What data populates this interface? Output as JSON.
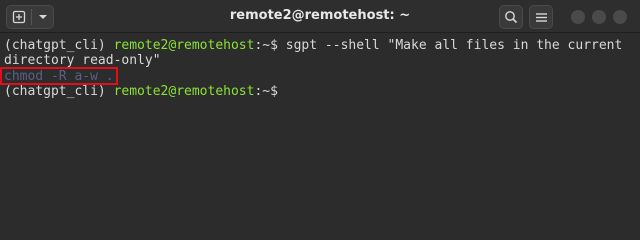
{
  "window": {
    "title": "remote2@remotehost: ~"
  },
  "toolbar": {
    "new_tab_icon": "new-tab-icon",
    "menu_icon": "chevron-down-icon",
    "search_icon": "search-icon",
    "hamburger_icon": "hamburger-menu-icon"
  },
  "terminal": {
    "lines": [
      {
        "env": "(chatgpt_cli) ",
        "user": "remote2@remotehost",
        "path": ":~$ ",
        "cmd": "sgpt --shell \"Make all files in the current"
      },
      {
        "text": "directory read-only\""
      },
      {
        "output": "chmod -R a-w ."
      },
      {
        "env": "(chatgpt_cli) ",
        "user": "remote2@remotehost",
        "path": ":~$ "
      }
    ]
  },
  "colors": {
    "background": "#2c2c2c",
    "prompt_green": "#8ae234",
    "suggestion": "#5c5f83",
    "highlight": "#e0101a"
  }
}
